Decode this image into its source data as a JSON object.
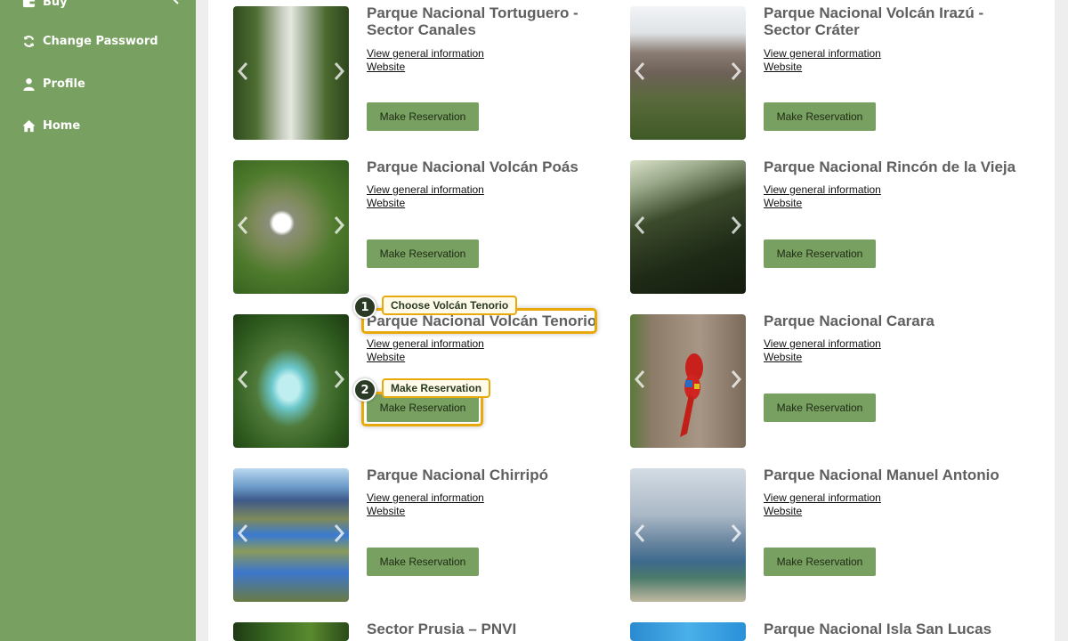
{
  "sidebar": {
    "items": [
      {
        "label": "Buy",
        "icon": "wallet-icon"
      },
      {
        "label": "Change Password",
        "icon": "refresh-icon"
      },
      {
        "label": "Profile",
        "icon": "user-icon"
      },
      {
        "label": "Home",
        "icon": "home-icon"
      }
    ]
  },
  "links": {
    "info": "View general information",
    "website": "Website"
  },
  "button_label": "Make Reservation",
  "parks": [
    {
      "name": "Parque Nacional Tortuguero - Sector Canales",
      "image": "river-canal-photo"
    },
    {
      "name": "Parque Nacional Volcán Irazú - Sector Cráter",
      "image": "volcano-crater-photo"
    },
    {
      "name": "Parque Nacional Volcán Poás",
      "image": "crater-lake-aerial-photo"
    },
    {
      "name": "Parque Nacional Rincón de la Vieja",
      "image": "forest-sunbeams-photo"
    },
    {
      "name": "Parque Nacional Volcán Tenorio",
      "image": "blue-waterfall-photo"
    },
    {
      "name": "Parque Nacional Carara",
      "image": "scarlet-macaw-photo"
    },
    {
      "name": "Parque Nacional Chirripó",
      "image": "mountain-lakes-photo"
    },
    {
      "name": "Parque Nacional Manuel Antonio",
      "image": "coast-island-photo"
    },
    {
      "name": "Sector Prusia – PNVI",
      "image": "green-forest-photo"
    },
    {
      "name": "Parque Nacional Isla San Lucas",
      "image": "blue-sea-photo"
    }
  ],
  "annotations": [
    {
      "step": "1",
      "label": "Choose Volcán Tenorio"
    },
    {
      "step": "2",
      "label": "Make Reservation"
    }
  ],
  "colors": {
    "sidebar": "#78a060",
    "button": "#78a060",
    "highlight": "#e8a90c",
    "title": "#5f5f5f"
  }
}
